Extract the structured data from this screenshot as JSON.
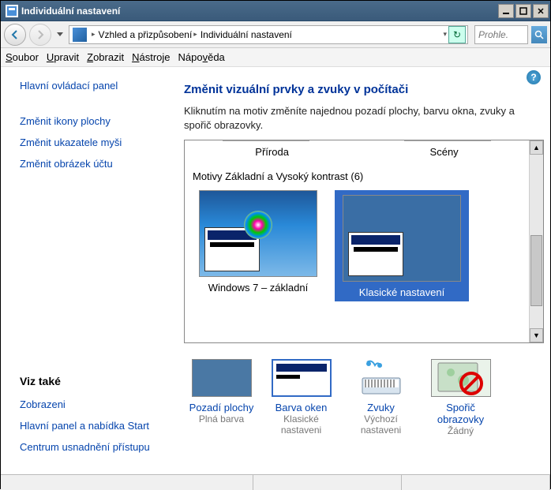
{
  "window": {
    "title": "Individuální nastavení"
  },
  "breadcrumb": {
    "seg1": "Vzhled a přizpůsobení",
    "seg2": "Individuální nastavení"
  },
  "search": {
    "placeholder": "Prohle..."
  },
  "menu": {
    "file": "Soubor",
    "edit": "Upravit",
    "view": "Zobrazit",
    "tools": "Nástroje",
    "help": "Nápověda"
  },
  "sidebar": {
    "links": {
      "main_panel": "Hlavní ovládací panel",
      "change_icons": "Změnit ikony plochy",
      "change_pointers": "Změnit ukazatele myši",
      "change_account_pic": "Změnit obrázek účtu"
    },
    "see_also": "Viz také",
    "see_links": {
      "display": "Zobrazeni",
      "taskbar": "Hlavní panel a nabídka Start",
      "ease": "Centrum usnadnění přístupu"
    }
  },
  "main": {
    "heading": "Změnit vizuální prvky a zvuky v počítači",
    "desc": "Kliknutím na motiv změníte najednou pozadí plochy, barvu okna, zvuky a spořič obrazovky.",
    "tab1": "Příroda",
    "tab2": "Scény",
    "group": "Motivy Základní a Vysoký kontrast (6)",
    "theme1": "Windows 7 – základní",
    "theme2": "Klasické nastavení"
  },
  "tiles": {
    "bg": {
      "label": "Pozadí plochy",
      "sub": "Plná barva"
    },
    "wincolor": {
      "label": "Barva oken",
      "sub": "Klasické nastaveni"
    },
    "sounds": {
      "label": "Zvuky",
      "sub": "Výchozí nastaveni"
    },
    "saver": {
      "label": "Spořič obrazovky",
      "sub": "Žádný"
    }
  }
}
